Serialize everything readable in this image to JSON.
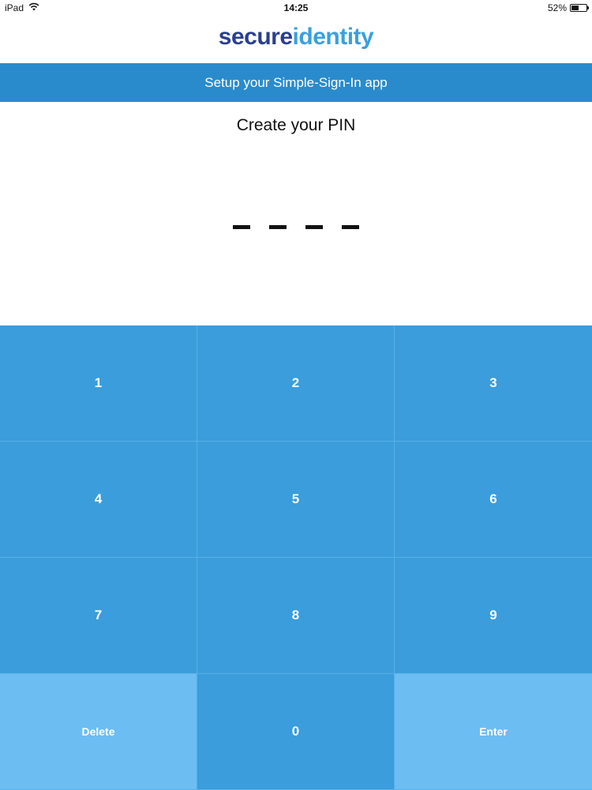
{
  "status_bar": {
    "device": "iPad",
    "time": "14:25",
    "battery_text": "52%",
    "battery_level": 0.52
  },
  "logo": {
    "part1": "secure",
    "part2": "identity"
  },
  "banner": {
    "text": "Setup your Simple-Sign-In app"
  },
  "pin": {
    "title": "Create your PIN",
    "slots": 4
  },
  "keypad": {
    "keys": [
      "1",
      "2",
      "3",
      "4",
      "5",
      "6",
      "7",
      "8",
      "9",
      "Delete",
      "0",
      "Enter"
    ]
  },
  "colors": {
    "banner": "#2a8bcc",
    "key": "#3b9ddb",
    "key_action": "#6cbdf2",
    "logo_secure": "#2a3f8f",
    "logo_identity": "#3aa0db"
  }
}
